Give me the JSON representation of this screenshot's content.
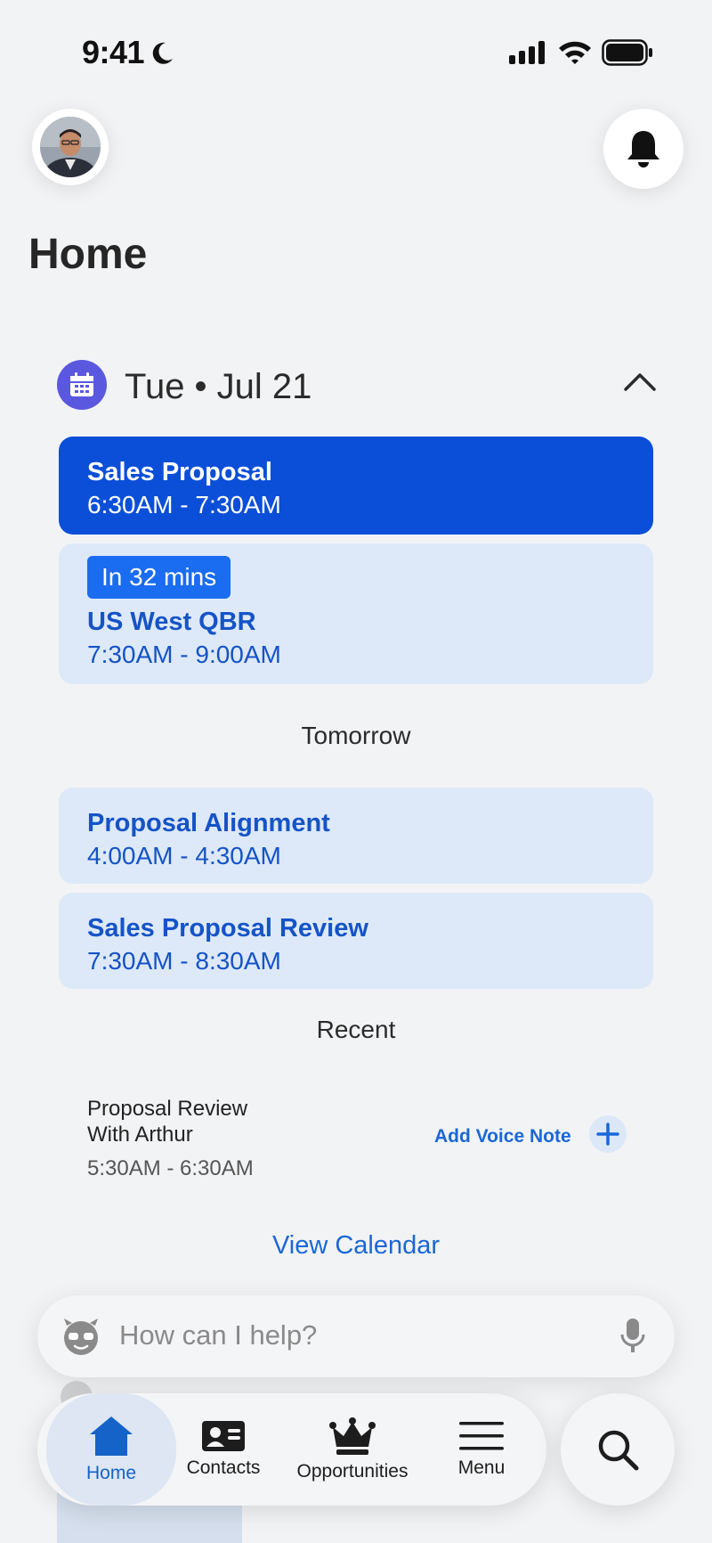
{
  "status_bar": {
    "time": "9:41"
  },
  "header": {
    "title": "Home"
  },
  "schedule": {
    "date_label": "Tue • Jul 21",
    "today": [
      {
        "title": "Sales Proposal",
        "time": "6:30AM - 7:30AM",
        "active": true
      },
      {
        "badge": "In 32 mins",
        "title": "US West QBR",
        "time": "7:30AM - 9:00AM",
        "active": false
      }
    ],
    "tomorrow_label": "Tomorrow",
    "tomorrow": [
      {
        "title": "Proposal Alignment",
        "time": "4:00AM - 4:30AM"
      },
      {
        "title": "Sales Proposal Review",
        "time": "7:30AM - 8:30AM"
      }
    ]
  },
  "recent": {
    "label": "Recent",
    "item": {
      "title_line1": "Proposal Review",
      "title_line2": "With Arthur",
      "time": "5:30AM - 6:30AM",
      "action": "Add Voice Note"
    }
  },
  "view_calendar": "View Calendar",
  "assistant": {
    "placeholder": "How can I help?"
  },
  "tabs": [
    {
      "label": "Home",
      "icon": "home-icon",
      "active": true
    },
    {
      "label": "Contacts",
      "icon": "contact-card-icon",
      "active": false
    },
    {
      "label": "Opportunities",
      "icon": "crown-icon",
      "active": false
    },
    {
      "label": "Menu",
      "icon": "menu-icon",
      "active": false
    }
  ],
  "colors": {
    "accent": "#0b4fd8",
    "link": "#1a67d8",
    "soft_card": "#dde9f8",
    "calendar_badge": "#5b58e0",
    "background": "#f2f3f5"
  }
}
